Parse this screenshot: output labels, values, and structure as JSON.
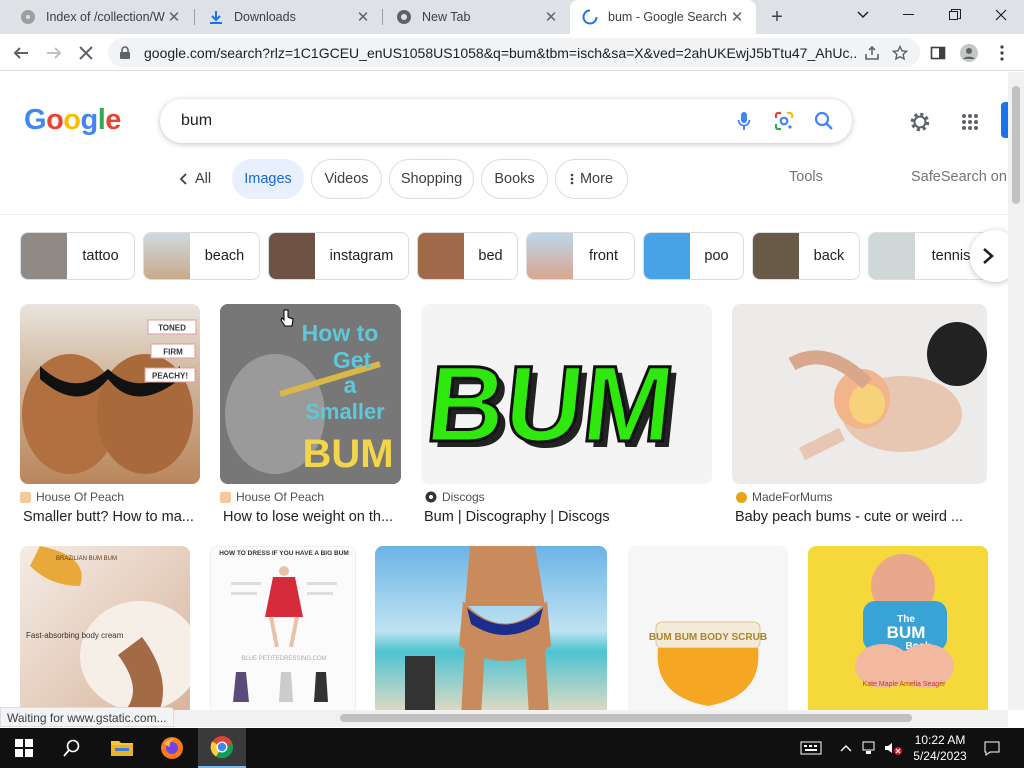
{
  "browser": {
    "tabs": [
      {
        "title": "Index of /collection/Wi",
        "icon": "cd-icon"
      },
      {
        "title": "Downloads",
        "icon": "download-icon"
      },
      {
        "title": "New Tab",
        "icon": "chrome-icon"
      },
      {
        "title": "bum - Google Search",
        "icon": "loading-icon",
        "active": true
      }
    ],
    "url": "google.com/search?rlz=1C1GCEU_enUS1058US1058&q=bum&tbm=isch&sa=X&ved=2ahUKEwjJ5bTtu47_AhUc...",
    "status": "Waiting for www.gstatic.com..."
  },
  "google": {
    "logo_letters": [
      {
        "ch": "G",
        "color": "#4285F4"
      },
      {
        "ch": "o",
        "color": "#EA4335"
      },
      {
        "ch": "o",
        "color": "#FBBC05"
      },
      {
        "ch": "g",
        "color": "#4285F4"
      },
      {
        "ch": "l",
        "color": "#34A853"
      },
      {
        "ch": "e",
        "color": "#EA4335"
      }
    ],
    "query": "bum",
    "nav": {
      "all": "All",
      "images": "Images",
      "videos": "Videos",
      "shopping": "Shopping",
      "books": "Books",
      "more": "More",
      "tools": "Tools",
      "safesearch": "SafeSearch on"
    },
    "related": [
      {
        "label": "tattoo",
        "thumb": "#8f8a86"
      },
      {
        "label": "beach",
        "thumb": "#c9a98a"
      },
      {
        "label": "instagram",
        "thumb": "#6e5244"
      },
      {
        "label": "bed",
        "thumb": "#a0694a"
      },
      {
        "label": "front",
        "thumb": "#d9a68e"
      },
      {
        "label": "poo",
        "thumb": "#47a3e6"
      },
      {
        "label": "back",
        "thumb": "#6a5a48"
      },
      {
        "label": "tennis",
        "thumb": "#cfd8d6"
      }
    ],
    "results_row1": [
      {
        "source": "House Of Peach",
        "title": "Smaller butt? How to ma...",
        "fav_color": "#f6c89b"
      },
      {
        "source": "House Of Peach",
        "title": "How to lose weight on th...",
        "fav_color": "#f6c89b"
      },
      {
        "source": "Discogs",
        "title": "Bum | Discography | Discogs",
        "fav_color": "#333333"
      },
      {
        "source": "MadeForMums",
        "title": "Baby peach bums - cute or weird ...",
        "fav_color": "#e8a317"
      }
    ],
    "image_text": {
      "peach_tags": [
        "TONED",
        "FIRM",
        "PEACHY!"
      ],
      "howto_lines": [
        "How to",
        "Get",
        "a",
        "Smaller"
      ],
      "howto_big": "BUM",
      "discogs_word": "BUM",
      "dress_title": "HOW TO DRESS IF YOU HAVE A BIG BUM",
      "dress_site": "BLUE PETITEDRESSING.COM",
      "cream_label": "Fast-absorbing body cream",
      "cream_lid": "BRAZILIAN BUM BUM",
      "scrub_label": "BUM BUM BODY SCRUB",
      "book_the": "The",
      "book_title": "BUM",
      "book_book": "Book",
      "book_authors": "Kate Maple  Amelia Seager"
    }
  },
  "taskbar": {
    "time": "10:22 AM",
    "date": "5/24/2023"
  }
}
